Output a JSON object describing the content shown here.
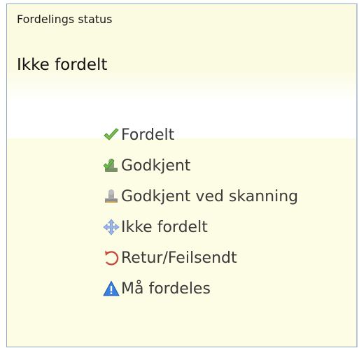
{
  "panel": {
    "header_label": "Fordelings status",
    "status_value": "Ikke fordelt"
  },
  "legend": {
    "items": [
      {
        "label": "Fordelt",
        "icon": "checkmark-icon",
        "color": "#5aa23a"
      },
      {
        "label": "Godkjent",
        "icon": "approved-stamp-icon",
        "color": "#4f8a3a"
      },
      {
        "label": "Godkjent ved skanning",
        "icon": "scan-stamp-icon",
        "color": "#9a9a9a"
      },
      {
        "label": "Ikke fordelt",
        "icon": "move-arrows-icon",
        "color": "#7f9ed8"
      },
      {
        "label": "Retur/Feilsendt",
        "icon": "return-arrow-icon",
        "color": "#c0453b"
      },
      {
        "label": "Må fordeles",
        "icon": "warning-icon",
        "color": "#2f6fd0"
      }
    ]
  }
}
